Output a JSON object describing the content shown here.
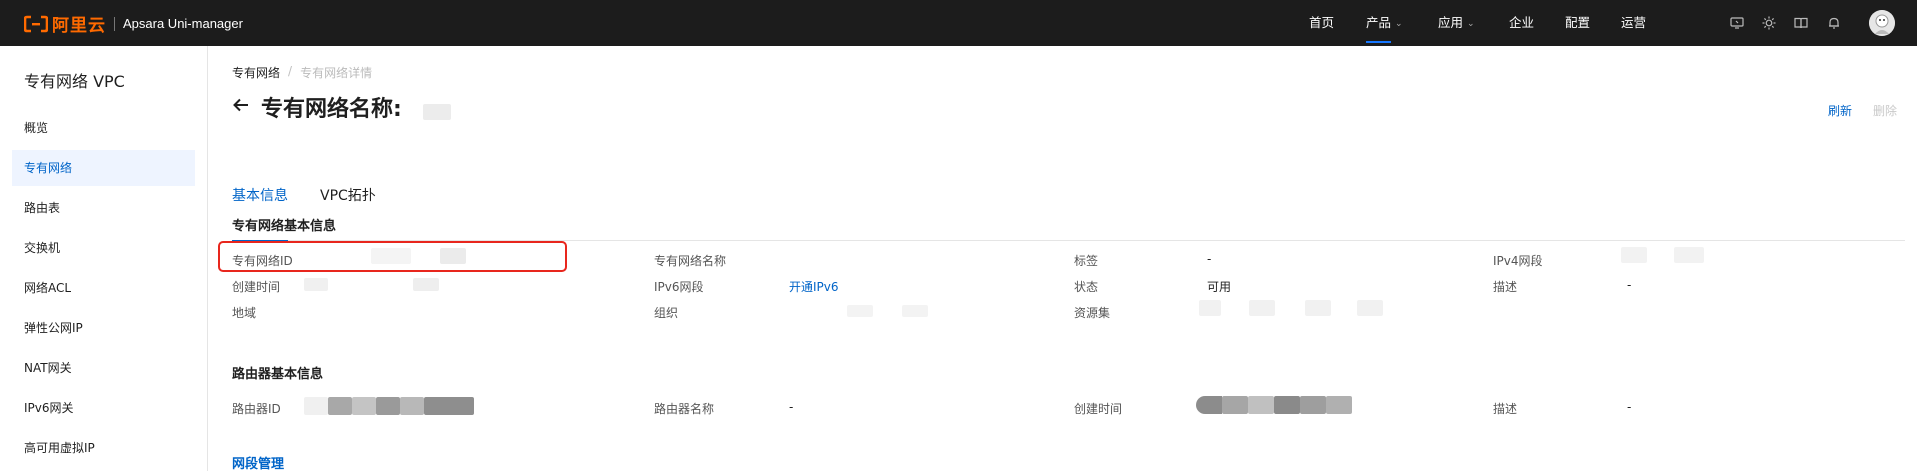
{
  "topbar": {
    "logo_text": "阿里云",
    "product_name": "Apsara Uni-manager",
    "nav": [
      {
        "label": "首页"
      },
      {
        "label": "产品"
      },
      {
        "label": "应用"
      },
      {
        "label": "企业"
      },
      {
        "label": "配置"
      },
      {
        "label": "运营"
      }
    ],
    "icons": [
      "help-monitor-icon",
      "theme-sun-icon",
      "docs-book-icon",
      "notification-bell-icon"
    ],
    "accent_color": "#ff6a00"
  },
  "sidebar": {
    "title": "专有网络 VPC",
    "items": [
      {
        "label": "概览"
      },
      {
        "label": "专有网络"
      },
      {
        "label": "路由表"
      },
      {
        "label": "交换机"
      },
      {
        "label": "网络ACL"
      },
      {
        "label": "弹性公网IP"
      },
      {
        "label": "NAT网关"
      },
      {
        "label": "IPv6网关"
      },
      {
        "label": "高可用虚拟IP"
      }
    ],
    "active_index": 1
  },
  "breadcrumb": {
    "parent": "专有网络",
    "separator": "/",
    "current": "专有网络详情"
  },
  "header": {
    "title": "专有网络名称:",
    "refresh_label": "刷新",
    "delete_label": "删除"
  },
  "tabs": [
    {
      "label": "基本信息"
    },
    {
      "label": "VPC拓扑"
    }
  ],
  "vpc_info": {
    "title": "专有网络基本信息",
    "vpc_id_label": "专有网络ID",
    "vpc_name_label": "专有网络名称",
    "tags_label": "标签",
    "tags_value": "-",
    "ipv4_label": "IPv4网段",
    "created_label": "创建时间",
    "ipv6_label": "IPv6网段",
    "ipv6_value": "开通IPv6",
    "status_label": "状态",
    "status_value": "可用",
    "desc_label": "描述",
    "desc_value": "-",
    "region_label": "地域",
    "org_label": "组织",
    "resource_set_label": "资源集"
  },
  "router_info": {
    "title": "路由器基本信息",
    "router_id_label": "路由器ID",
    "router_name_label": "路由器名称",
    "router_name_value": "-",
    "created_label": "创建时间",
    "desc_label": "描述",
    "desc_value": "-"
  },
  "segment_section": {
    "title": "网段管理"
  }
}
